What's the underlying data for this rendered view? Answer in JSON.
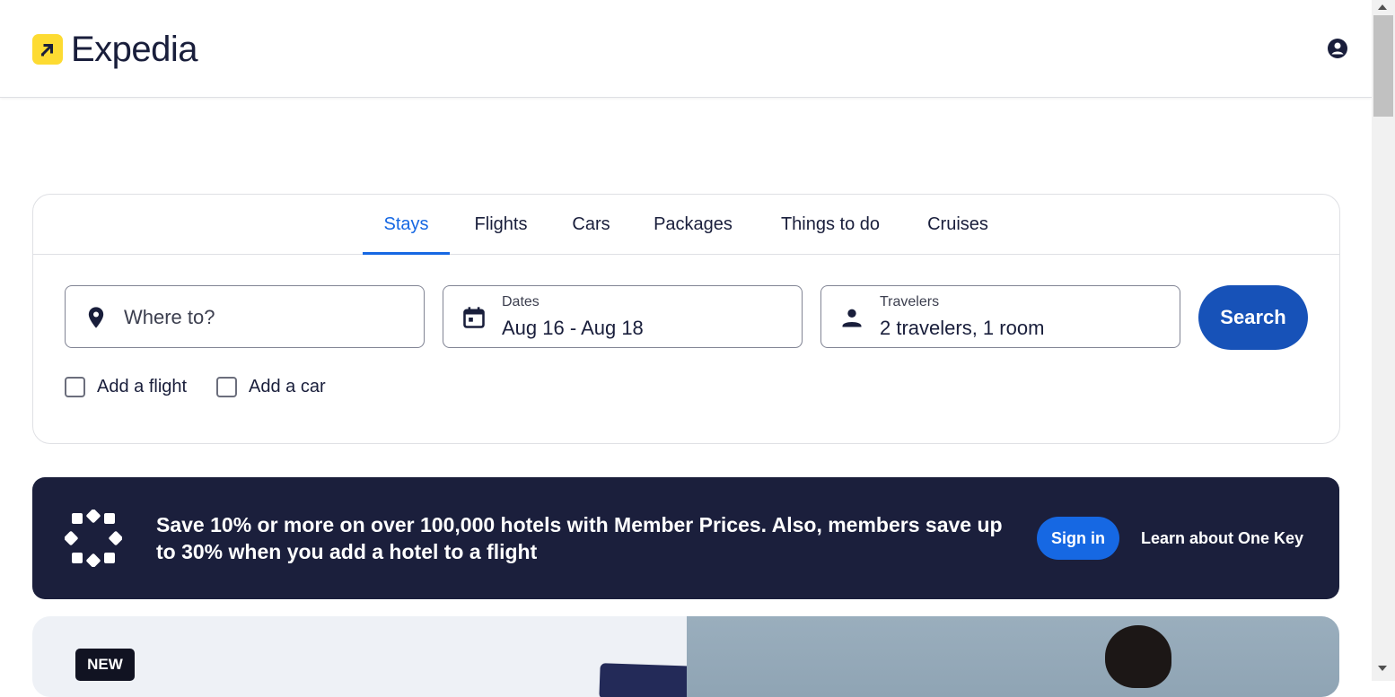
{
  "header": {
    "logo_text": "Expedia",
    "account_icon": "account-circle-icon"
  },
  "tabs": [
    {
      "label": "Stays",
      "active": true
    },
    {
      "label": "Flights",
      "active": false
    },
    {
      "label": "Cars",
      "active": false
    },
    {
      "label": "Packages",
      "active": false
    },
    {
      "label": "Things to do",
      "active": false
    },
    {
      "label": "Cruises",
      "active": false
    }
  ],
  "search": {
    "destination_placeholder": "Where to?",
    "dates_label": "Dates",
    "dates_value": "Aug 16 - Aug 18",
    "travelers_label": "Travelers",
    "travelers_value": "2 travelers, 1 room",
    "search_button": "Search",
    "add_flight_label": "Add a flight",
    "add_car_label": "Add a car"
  },
  "banner": {
    "text": "Save 10% or more on over 100,000 hotels with Member Prices. Also, members save up to 30% when you add a hotel to a flight",
    "sign_in_button": "Sign in",
    "learn_link": "Learn about One Key"
  },
  "promo": {
    "badge": "NEW"
  },
  "colors": {
    "accent": "#1668e3",
    "search_button": "#1752b8",
    "banner_bg": "#1b1f3c",
    "logo_yellow": "#fddb32",
    "text_dark": "#191e3b"
  }
}
